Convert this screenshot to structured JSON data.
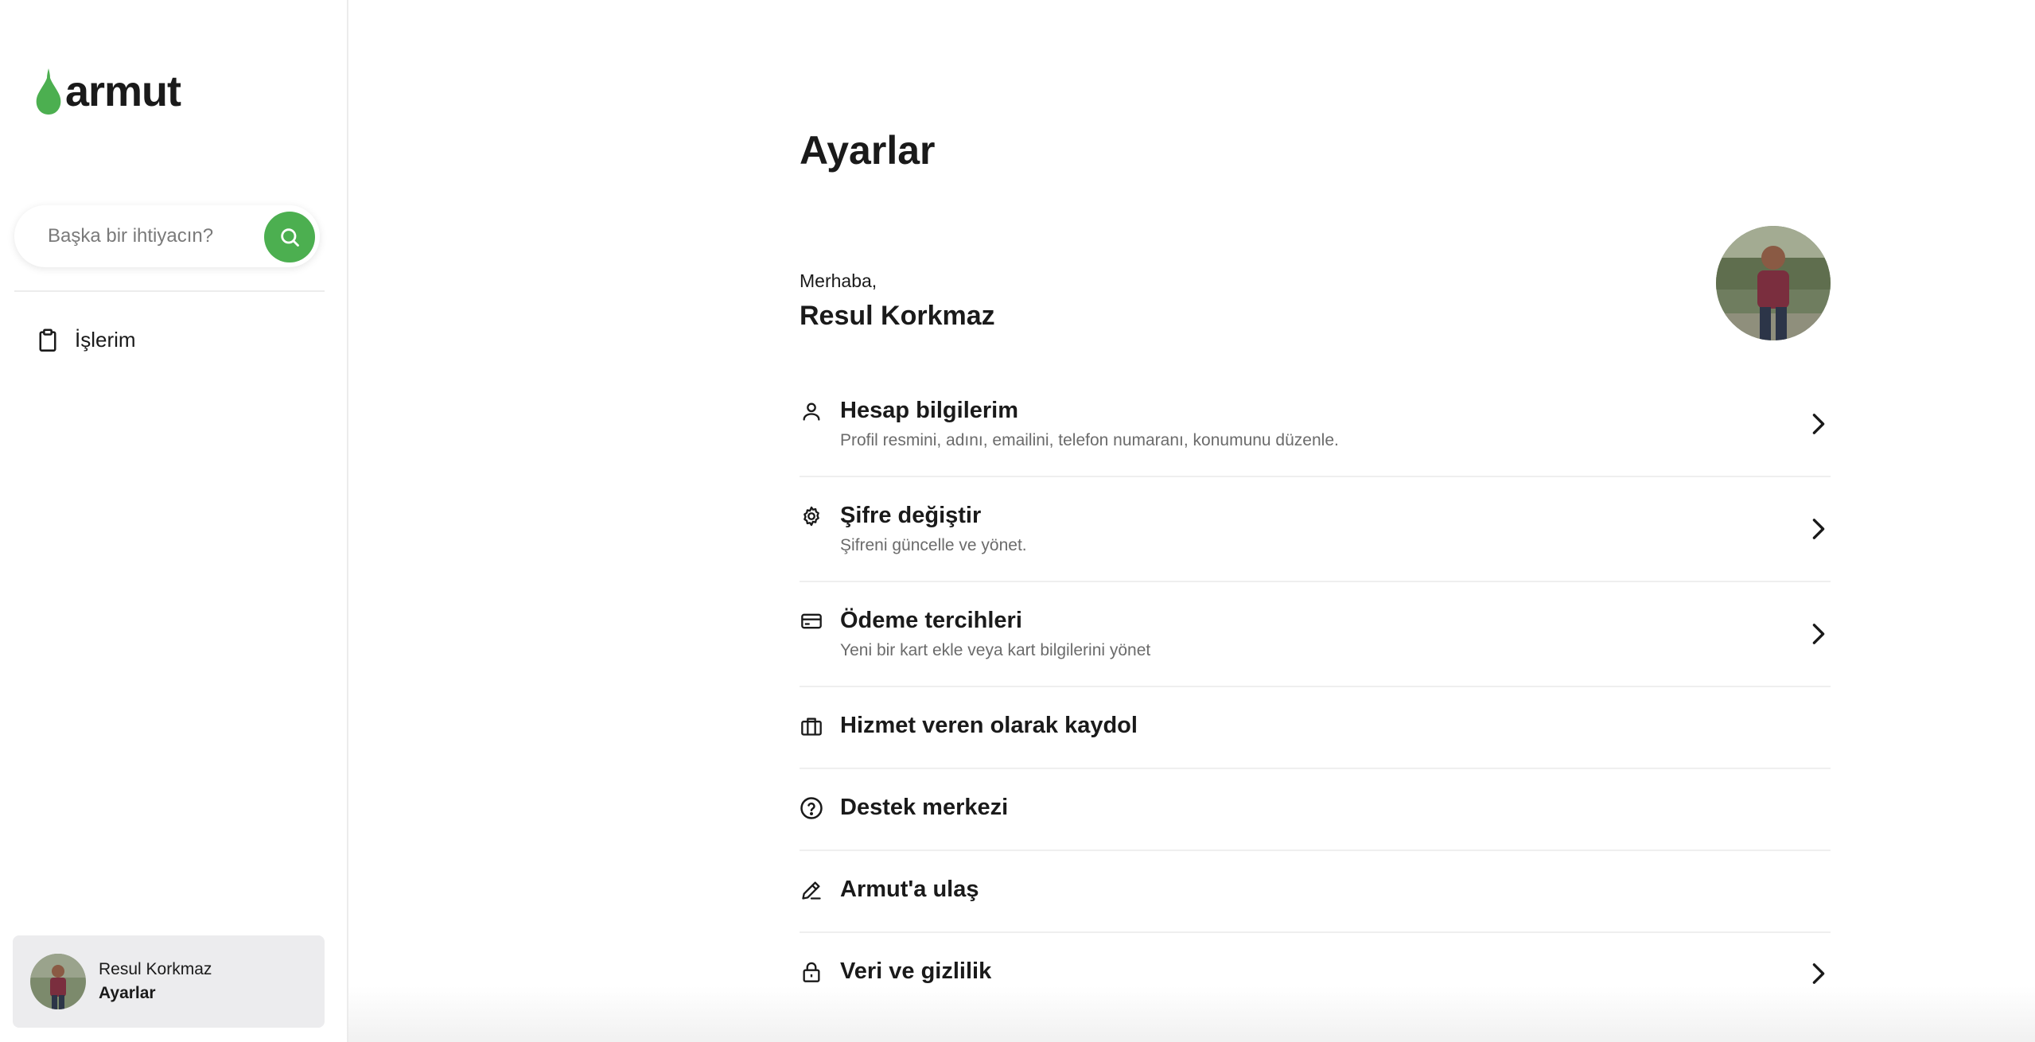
{
  "brand": {
    "name": "armut",
    "color": "#4caf50"
  },
  "search": {
    "placeholder": "Başka bir ihtiyacın?"
  },
  "sidebar": {
    "items": [
      {
        "label": "İşlerim",
        "icon": "clipboard-icon"
      }
    ],
    "user_card": {
      "name": "Resul Korkmaz",
      "subtitle": "Ayarlar"
    }
  },
  "main": {
    "title": "Ayarlar",
    "greeting": "Merhaba,",
    "user_name": "Resul Korkmaz",
    "menu": [
      {
        "title": "Hesap bilgilerim",
        "desc": "Profil resmini, adını, emailini, telefon numaranı, konumunu düzenle.",
        "icon": "user-icon",
        "chevron": true
      },
      {
        "title": "Şifre değiştir",
        "desc": "Şifreni güncelle ve yönet.",
        "icon": "gear-icon",
        "chevron": true
      },
      {
        "title": "Ödeme tercihleri",
        "desc": "Yeni bir kart ekle veya kart bilgilerini yönet",
        "icon": "credit-card-icon",
        "chevron": true
      },
      {
        "title": "Hizmet veren olarak kaydol",
        "icon": "briefcase-icon",
        "chevron": false
      },
      {
        "title": "Destek merkezi",
        "icon": "help-circle-icon",
        "chevron": false
      },
      {
        "title": "Armut'a ulaş",
        "icon": "pen-icon",
        "chevron": false
      },
      {
        "title": "Veri ve gizlilik",
        "icon": "lock-icon",
        "chevron": true
      }
    ]
  }
}
